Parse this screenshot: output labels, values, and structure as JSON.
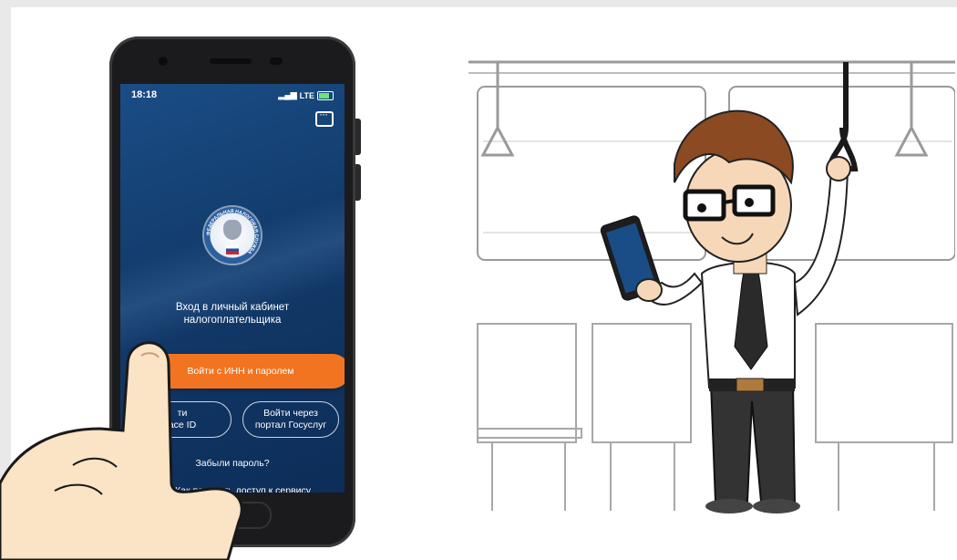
{
  "status_bar": {
    "time": "18:18",
    "network": "LTE"
  },
  "app": {
    "logo_text": "ФЕДЕРАЛЬНАЯ НАЛОГОВАЯ СЛУЖБА",
    "title_line1": "Вход в личный кабинет",
    "title_line2": "налогоплательщика",
    "primary_button": "Войти с ИНН и паролем",
    "face_id_line1": "ти",
    "face_id_line2": "ace ID",
    "gosuslugi_line1": "Войти через",
    "gosuslugi_line2": "портал Госуслуг",
    "forgot_password": "Забыли пароль?",
    "access_link": "Как получить доступ к сервису"
  },
  "colors": {
    "accent": "#f27420",
    "screen_bg": "#123a6a"
  },
  "icons": [
    "chat-icon",
    "battery-icon",
    "signal-icon",
    "fns-emblem-icon"
  ]
}
